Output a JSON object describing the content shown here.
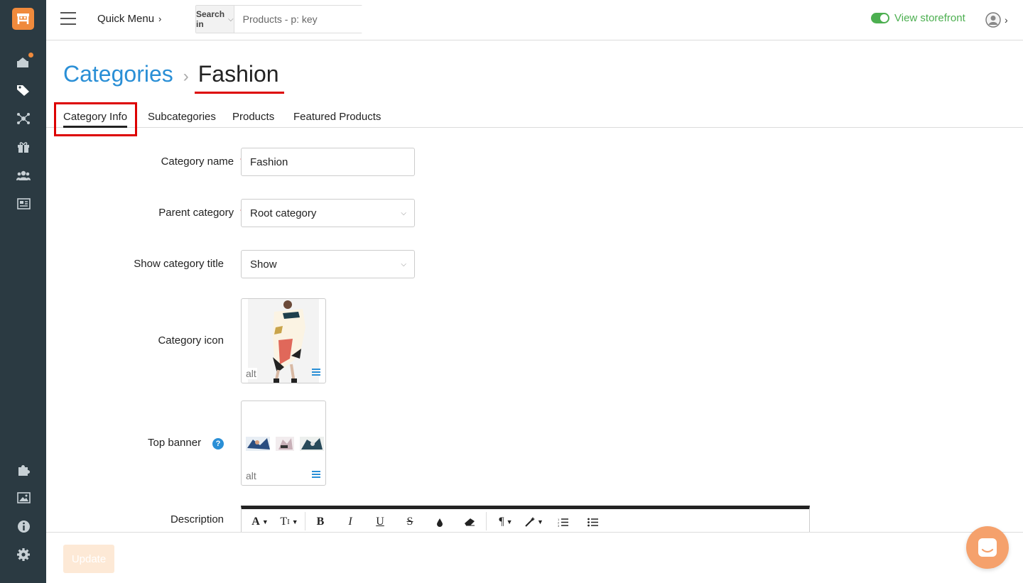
{
  "colors": {
    "sidebar": "#2b3a42",
    "accent": "#f08a3c",
    "link": "#2a8fd6",
    "success": "#4caf50",
    "highlight": "#d00"
  },
  "sidebar": {
    "icons": [
      "logo-icon",
      "dashboard-icon",
      "tag-icon",
      "network-icon",
      "gift-icon",
      "users-icon",
      "news-icon",
      "puzzle-icon",
      "image-icon",
      "info-icon",
      "gear-icon"
    ]
  },
  "header": {
    "quick_menu": "Quick Menu",
    "search_in": "Search in",
    "search_placeholder": "Products - p: key",
    "view_storefront": "View storefront"
  },
  "breadcrumb": {
    "parent": "Categories",
    "current": "Fashion"
  },
  "tabs": [
    "Category Info",
    "Subcategories",
    "Products",
    "Featured Products"
  ],
  "form": {
    "category_name_label": "Category name",
    "category_name_value": "Fashion",
    "parent_category_label": "Parent category",
    "parent_category_value": "Root category",
    "show_title_label": "Show category title",
    "show_title_value": "Show",
    "category_icon_label": "Category icon",
    "top_banner_label": "Top banner",
    "description_label": "Description",
    "alt_text": "alt",
    "required_mark": "*",
    "help_mark": "?"
  },
  "editor_toolbar": [
    "font-color",
    "text-size",
    "bold",
    "italic",
    "underline",
    "strikethrough",
    "highlight",
    "eraser",
    "paragraph",
    "magic",
    "ordered-list",
    "unordered-list"
  ],
  "footer": {
    "update_label": "Update"
  }
}
